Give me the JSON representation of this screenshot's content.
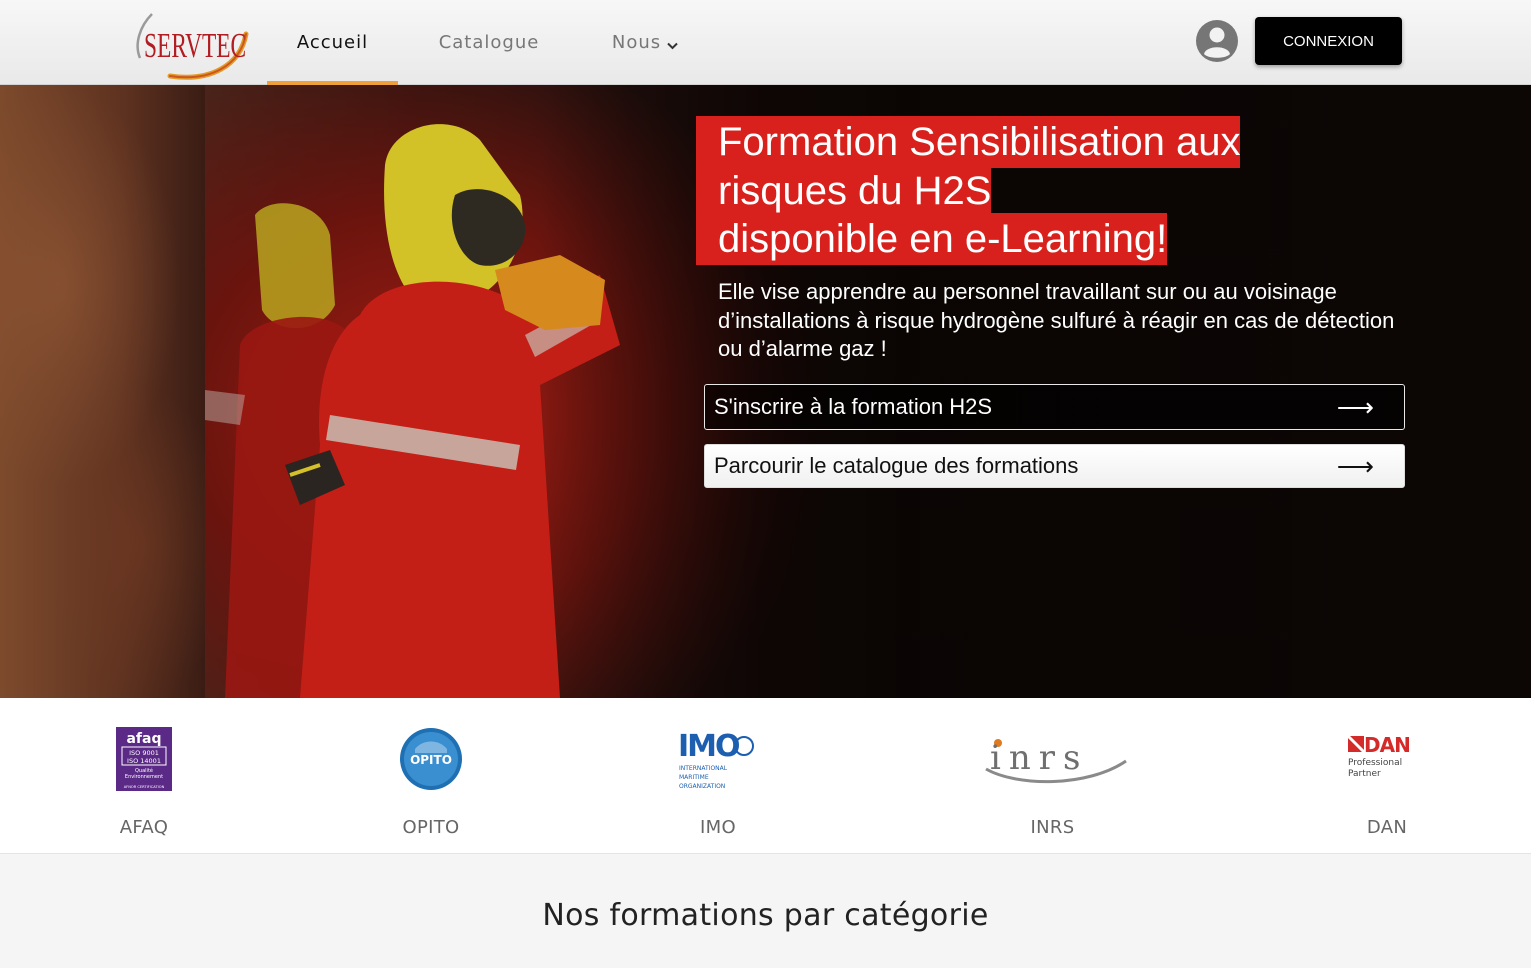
{
  "brand": {
    "logo_text": "SERVTEC",
    "accent": "#f0a03a",
    "hero_red": "#d8201c"
  },
  "nav": {
    "items": [
      {
        "label": "Accueil",
        "active": true
      },
      {
        "label": "Catalogue",
        "active": false
      },
      {
        "label": "Nous",
        "active": false,
        "has_dropdown": true
      }
    ],
    "user_icon": "user-circle-icon",
    "login_label": "CONNEXION"
  },
  "hero": {
    "title_lines": [
      "Formation Sensibilisation aux",
      "risques du H2S",
      "disponible en e-Learning!"
    ],
    "description": "Elle vise apprendre au personnel travaillant sur ou au voisinage d’installations à risque hydrogène sulfuré à réagir en cas de détection ou d’alarme gaz !",
    "buttons": [
      {
        "label": "S'inscrire à la formation H2S",
        "icon": "arrow-right-icon"
      },
      {
        "label": "Parcourir le catalogue des formations",
        "icon": "arrow-right-icon"
      }
    ]
  },
  "partners": [
    {
      "name": "AFAQ",
      "logo": "afaq-logo",
      "logo_lines": [
        "afaq",
        "ISO 9001",
        "ISO 14001",
        "Qualité",
        "Environnement",
        "AFNOR CERTIFICATION"
      ]
    },
    {
      "name": "OPITO",
      "logo": "opito-logo",
      "logo_text": "OPITO"
    },
    {
      "name": "IMO",
      "logo": "imo-logo",
      "logo_lines": [
        "IMO",
        "INTERNATIONAL",
        "MARITIME",
        "ORGANIZATION"
      ]
    },
    {
      "name": "INRS",
      "logo": "inrs-logo",
      "logo_text": "inrs"
    },
    {
      "name": "DAN",
      "logo": "dan-logo",
      "logo_lines": [
        "DAN",
        "Professional",
        "Partner"
      ]
    }
  ],
  "section": {
    "title": "Nos formations par catégorie"
  }
}
